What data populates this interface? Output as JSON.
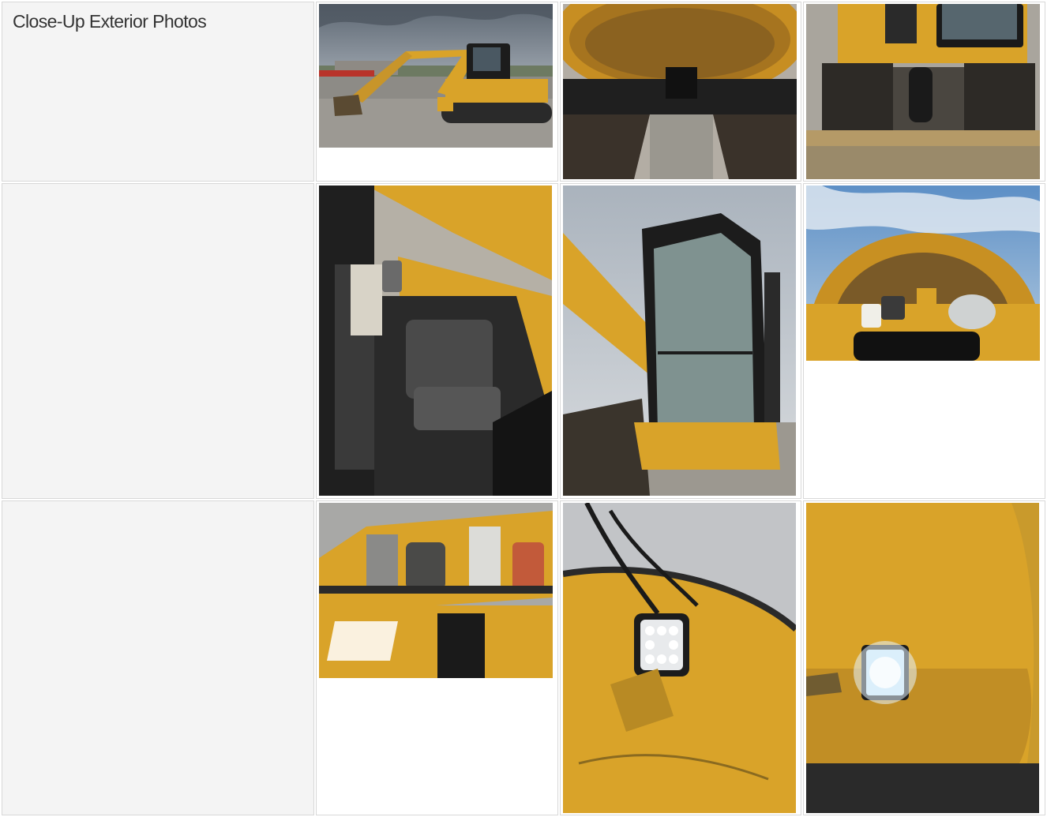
{
  "section": {
    "title": "Close-Up Exterior Photos"
  },
  "photos": [
    {
      "name": "excavator-side-view",
      "icon": "excavator-side-photo"
    },
    {
      "name": "undercarriage-swing-bearing",
      "icon": "undercarriage-photo"
    },
    {
      "name": "front-tracks-blade",
      "icon": "tracks-blade-photo"
    },
    {
      "name": "cab-interior-seat",
      "icon": "cab-seat-photo"
    },
    {
      "name": "cab-door-rear",
      "icon": "cab-door-photo"
    },
    {
      "name": "engine-compartment-open",
      "icon": "engine-hood-photo"
    },
    {
      "name": "engine-components",
      "icon": "engine-parts-photo"
    },
    {
      "name": "work-light-mounted",
      "icon": "work-light-photo"
    },
    {
      "name": "work-light-on",
      "icon": "work-light-on-photo"
    }
  ],
  "colors": {
    "cat_yellow": "#d9a329",
    "cab_black": "#1c1c1c",
    "sky": "#9aa3ad",
    "gravel": "#a8a49c"
  }
}
